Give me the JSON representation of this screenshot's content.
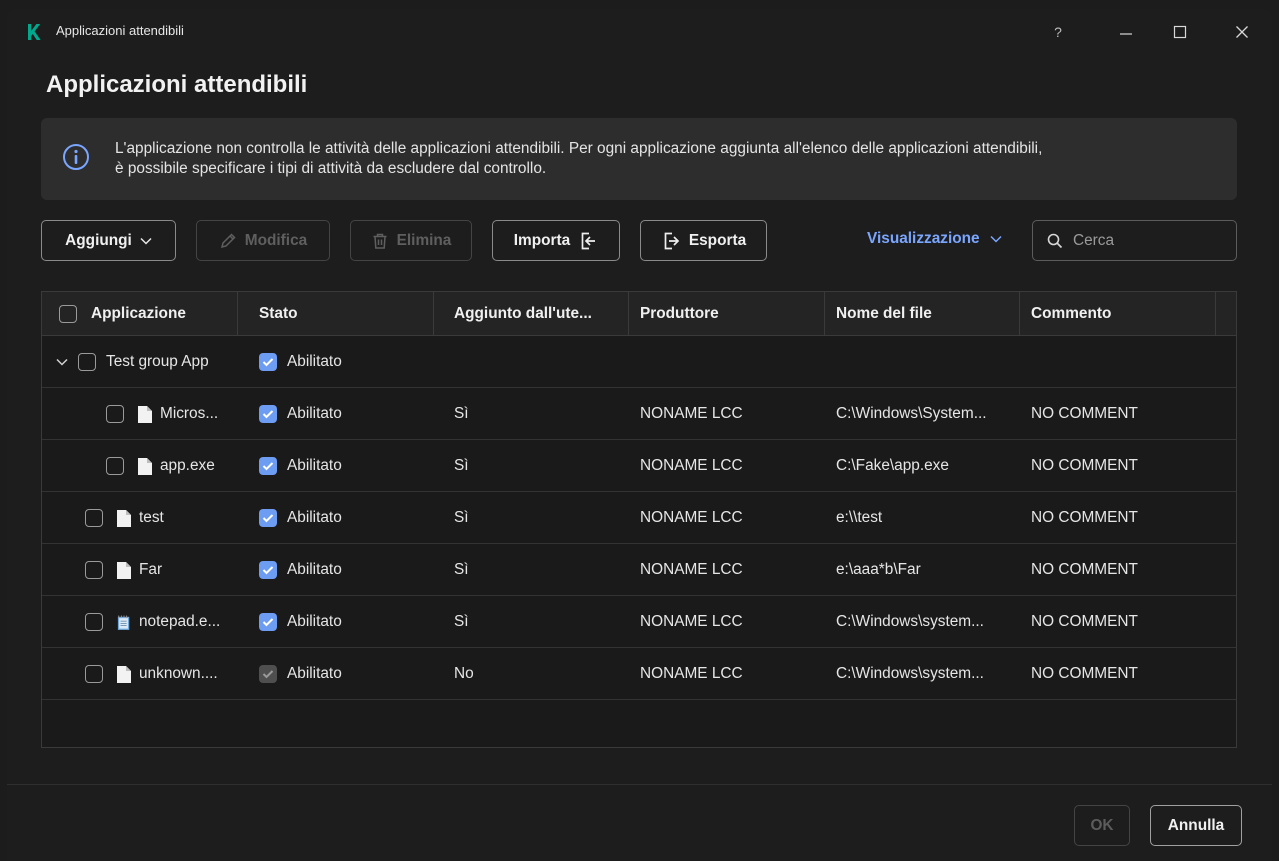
{
  "window": {
    "title": "Applicazioni attendibili",
    "help_label": "?"
  },
  "page": {
    "title": "Applicazioni attendibili"
  },
  "banner": {
    "text_line1": "L'applicazione non controlla le attività delle applicazioni attendibili. Per ogni applicazione aggiunta all'elenco delle applicazioni attendibili,",
    "text_line2": "è possibile specificare i tipi di attività da escludere dal controllo."
  },
  "toolbar": {
    "add_label": "Aggiungi",
    "edit_label": "Modifica",
    "delete_label": "Elimina",
    "import_label": "Importa",
    "export_label": "Esporta",
    "view_label": "Visualizzazione",
    "search_placeholder": "Cerca"
  },
  "table": {
    "columns": [
      "Applicazione",
      "Stato",
      "Aggiunto dall'ute...",
      "Produttore",
      "Nome del file",
      "Commento"
    ],
    "rows": [
      {
        "name": "Test group App",
        "status": "Abilitato",
        "added_by_user": "",
        "vendor": "",
        "file": "",
        "comment": ""
      },
      {
        "name": "Micros...",
        "status": "Abilitato",
        "added_by_user": "Sì",
        "vendor": "NONAME LCC",
        "file": "C:\\Windows\\System...",
        "comment": "NO COMMENT"
      },
      {
        "name": "app.exe",
        "status": "Abilitato",
        "added_by_user": "Sì",
        "vendor": "NONAME LCC",
        "file": "C:\\Fake\\app.exe",
        "comment": "NO COMMENT"
      },
      {
        "name": "test",
        "status": "Abilitato",
        "added_by_user": "Sì",
        "vendor": "NONAME LCC",
        "file": "e:\\\\test",
        "comment": "NO COMMENT"
      },
      {
        "name": "Far",
        "status": "Abilitato",
        "added_by_user": "Sì",
        "vendor": "NONAME LCC",
        "file": "e:\\aaa*b\\Far",
        "comment": "NO COMMENT"
      },
      {
        "name": "notepad.e...",
        "status": "Abilitato",
        "added_by_user": "Sì",
        "vendor": "NONAME LCC",
        "file": "C:\\Windows\\system...",
        "comment": "NO COMMENT"
      },
      {
        "name": "unknown....",
        "status": "Abilitato",
        "added_by_user": "No",
        "vendor": "NONAME LCC",
        "file": "C:\\Windows\\system...",
        "comment": "NO COMMENT"
      }
    ]
  },
  "footer": {
    "ok_label": "OK",
    "cancel_label": "Annulla"
  },
  "colors": {
    "accent": "#7aa6ff",
    "checkbox": "#6d9cf3",
    "logo": "#00a88e",
    "background": "#1d1d1d"
  }
}
